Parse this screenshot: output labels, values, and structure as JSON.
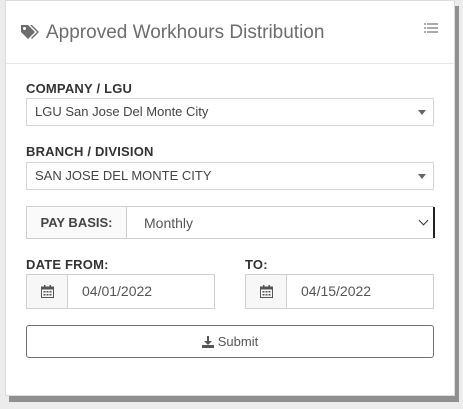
{
  "panel": {
    "title": "Approved Workhours Distribution",
    "icons": {
      "title_icon": "tags-icon",
      "menu_icon": "list-icon"
    }
  },
  "form": {
    "company": {
      "label": "COMPANY / LGU",
      "value": "LGU San Jose Del Monte City"
    },
    "branch": {
      "label": "BRANCH / DIVISION",
      "value": "SAN JOSE DEL MONTE CITY"
    },
    "pay_basis": {
      "label": "PAY BASIS:",
      "value": "Monthly"
    },
    "date_from": {
      "label": "DATE FROM:",
      "value": "04/01/2022"
    },
    "date_to": {
      "label": "TO:",
      "value": "04/15/2022"
    },
    "submit_label": "Submit"
  },
  "colors": {
    "title_text": "#6d6d6d",
    "panel_shadow": "#8f8f8f",
    "border": "#d6d6d6"
  }
}
